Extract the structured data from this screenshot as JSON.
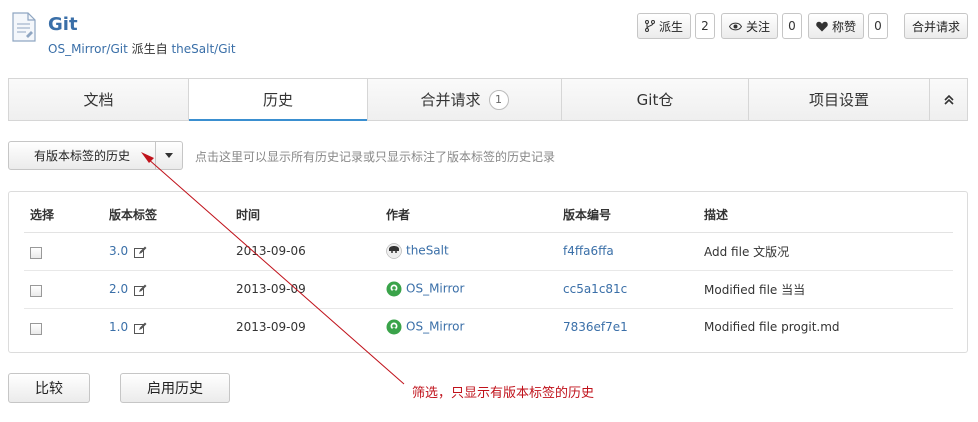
{
  "repo": {
    "name": "Git",
    "owner_path": "OS_Mirror/Git",
    "forked_from_label": " 派生自 ",
    "forked_from": "theSalt/Git"
  },
  "actions": {
    "fork_label": "派生",
    "fork_count": "2",
    "watch_label": "关注",
    "watch_count": "0",
    "star_label": "称赞",
    "star_count": "0",
    "pull_request_label": "合并请求"
  },
  "tabs": [
    {
      "label": "文档"
    },
    {
      "label": "历史"
    },
    {
      "label": "合并请求",
      "badge": "1"
    },
    {
      "label": "Git仓"
    },
    {
      "label": "项目设置"
    }
  ],
  "filter": {
    "selected": "有版本标签的历史",
    "hint": "点击这里可以显示所有历史记录或只显示标注了版本标签的历史记录"
  },
  "table": {
    "headers": [
      "选择",
      "版本标签",
      "时间",
      "作者",
      "版本编号",
      "描述"
    ],
    "rows": [
      {
        "tag": "3.0",
        "date": "2013-09-06",
        "author": "theSalt",
        "commit": "f4ffa6ffa",
        "desc": "Add file 文版况"
      },
      {
        "tag": "2.0",
        "date": "2013-09-09",
        "author": "OS_Mirror",
        "commit": "cc5a1c81c",
        "desc": "Modified file 当当"
      },
      {
        "tag": "1.0",
        "date": "2013-09-09",
        "author": "OS_Mirror",
        "commit": "7836ef7e1",
        "desc": "Modified file progit.md"
      }
    ]
  },
  "buttons": {
    "compare": "比较",
    "enable_history": "启用历史"
  },
  "annotation": "筛选，只显示有版本标签的历史",
  "colors": {
    "link": "#3a6fa8",
    "active_tab_underline": "#3a8fd0",
    "annotation": "#c0121b",
    "os_mirror_avatar": "#3aa34a"
  }
}
